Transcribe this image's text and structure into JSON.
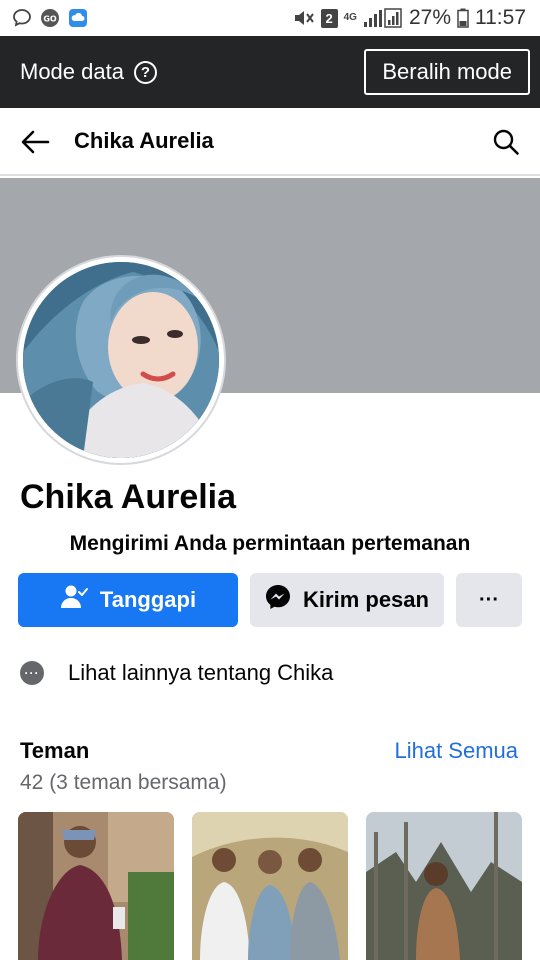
{
  "status_bar": {
    "battery": "27%",
    "time": "11:57",
    "sim_badge": "2",
    "network_type": "4G",
    "icons": [
      "chat-bubble-icon",
      "go-app-icon",
      "cloud-app-icon",
      "mute-icon",
      "sim-badge-icon",
      "signal-icon",
      "battery-icon"
    ]
  },
  "data_bar": {
    "label": "Mode data",
    "help_symbol": "?",
    "switch_label": "Beralih mode"
  },
  "header": {
    "title": "Chika Aurelia"
  },
  "profile": {
    "name": "Chika Aurelia",
    "friend_request_note": "Mengirimi Anda permintaan pertemanan",
    "respond_label": "Tanggapi",
    "message_label": "Kirim pesan",
    "more_label": "···",
    "see_more_label": "Lihat lainnya tentang Chika"
  },
  "friends": {
    "title": "Teman",
    "see_all": "Lihat Semua",
    "count": "42 (3 teman bersama)"
  },
  "colors": {
    "primary_blue": "#1877f2",
    "link_blue": "#216fdb",
    "dark_bar": "#242526",
    "cover_gray": "#a4a7ab",
    "secondary_button": "#e4e6eb"
  }
}
